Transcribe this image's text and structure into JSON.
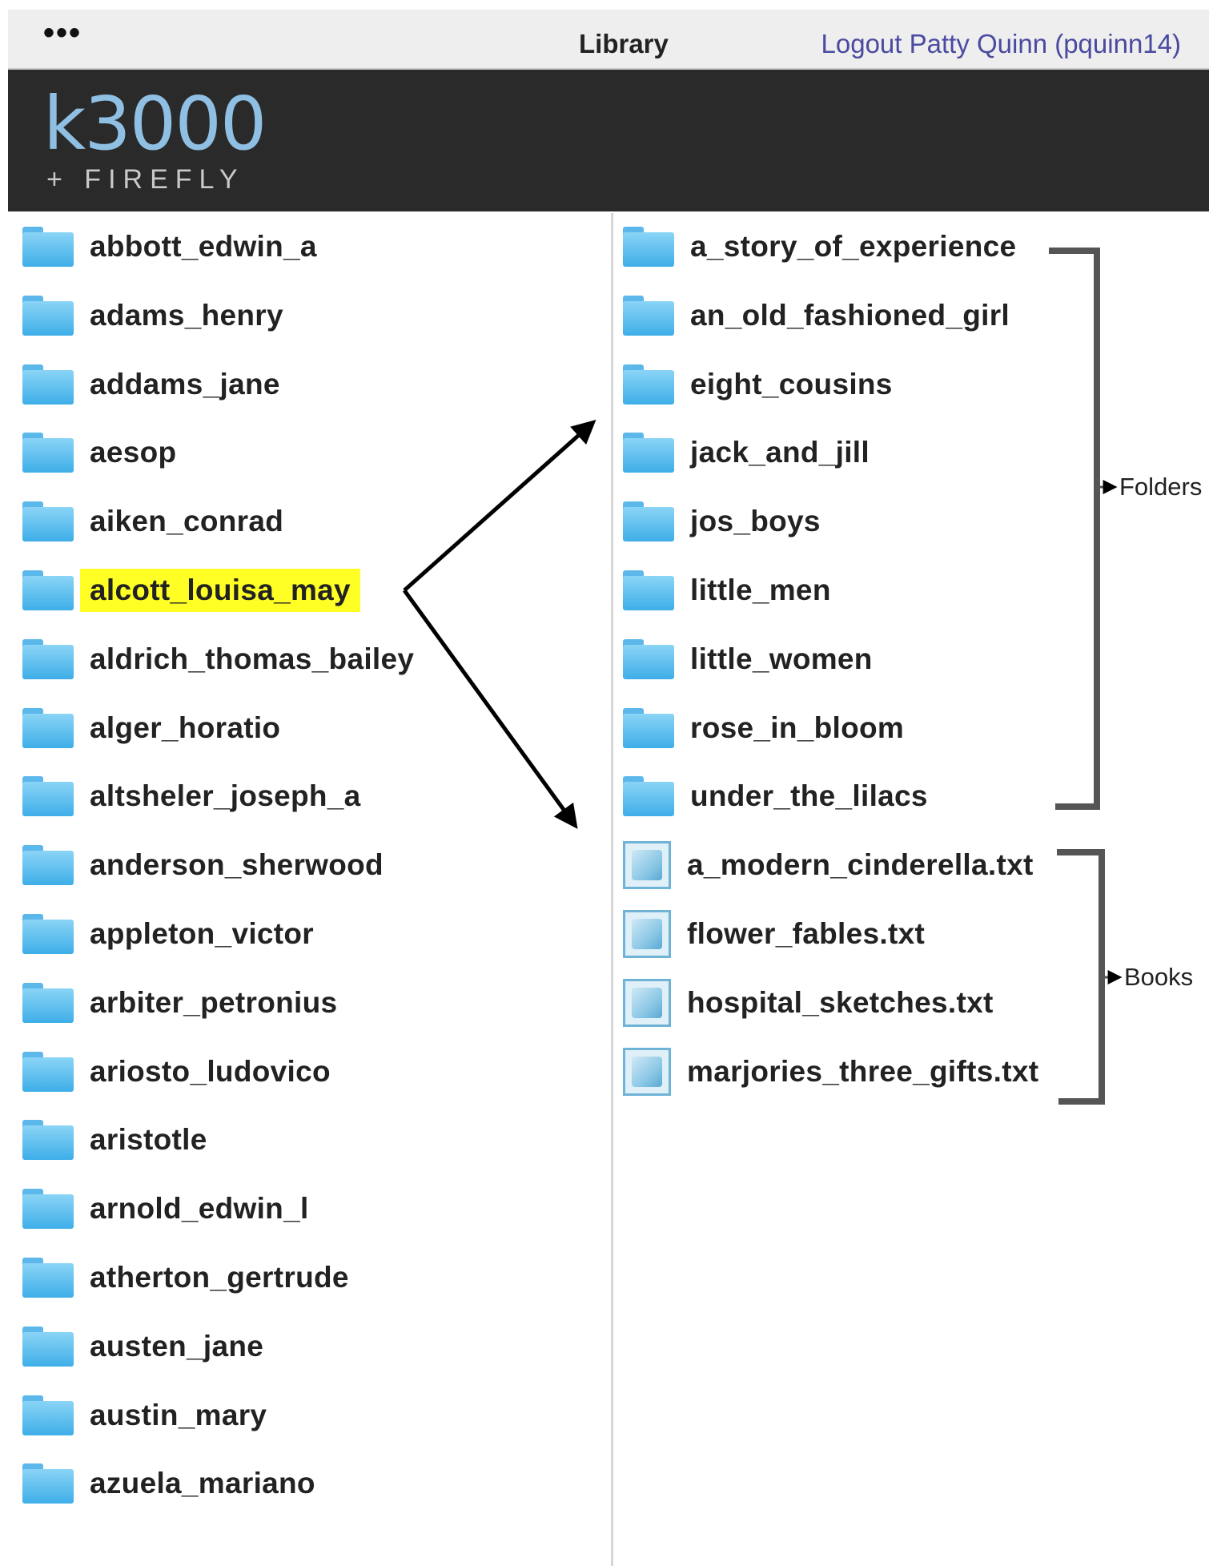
{
  "header": {
    "more_label": "•••",
    "title": "Library",
    "logout_label": "Logout Patty Quinn (pquinn14)"
  },
  "banner": {
    "logo_main": "k3000",
    "logo_sub": "+ FIREFLY"
  },
  "authors": [
    {
      "label": "abbott_edwin_a",
      "selected": false
    },
    {
      "label": "adams_henry",
      "selected": false
    },
    {
      "label": "addams_jane",
      "selected": false
    },
    {
      "label": "aesop",
      "selected": false
    },
    {
      "label": "aiken_conrad",
      "selected": false
    },
    {
      "label": "alcott_louisa_may",
      "selected": true
    },
    {
      "label": "aldrich_thomas_bailey",
      "selected": false
    },
    {
      "label": "alger_horatio",
      "selected": false
    },
    {
      "label": "altsheler_joseph_a",
      "selected": false
    },
    {
      "label": "anderson_sherwood",
      "selected": false
    },
    {
      "label": "appleton_victor",
      "selected": false
    },
    {
      "label": "arbiter_petronius",
      "selected": false
    },
    {
      "label": "ariosto_ludovico",
      "selected": false
    },
    {
      "label": "aristotle",
      "selected": false
    },
    {
      "label": "arnold_edwin_l",
      "selected": false
    },
    {
      "label": "atherton_gertrude",
      "selected": false
    },
    {
      "label": "austen_jane",
      "selected": false
    },
    {
      "label": "austin_mary",
      "selected": false
    },
    {
      "label": "azuela_mariano",
      "selected": false
    }
  ],
  "folders": [
    "a_story_of_experience",
    "an_old_fashioned_girl",
    "eight_cousins",
    "jack_and_jill",
    "jos_boys",
    "little_men",
    "little_women",
    "rose_in_bloom",
    "under_the_lilacs"
  ],
  "books": [
    "a_modern_cinderella.txt",
    "flower_fables.txt",
    "hospital_sketches.txt",
    "marjories_three_gifts.txt"
  ],
  "annotations": {
    "folders_label": "Folders",
    "books_label": "Books"
  },
  "colors": {
    "highlight": "#ffff26",
    "banner_bg": "#2a2a2a",
    "logo_blue": "#8fbfe3",
    "link": "#4a4aa0",
    "folder_blue": "#5cb8ea"
  },
  "icons": {
    "folder": "folder-icon",
    "book": "book-file-icon"
  }
}
